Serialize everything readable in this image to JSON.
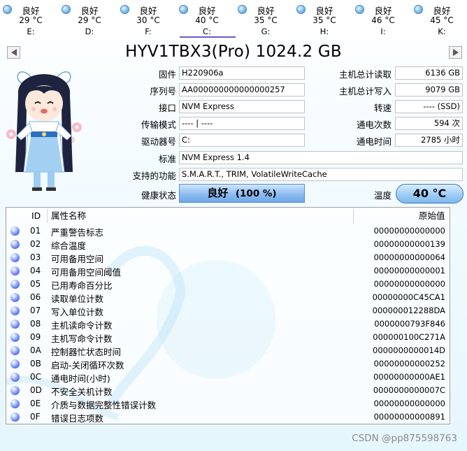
{
  "drives": [
    {
      "status": "良好",
      "temp": "29 °C",
      "letter": "E:"
    },
    {
      "status": "良好",
      "temp": "29 °C",
      "letter": "D:"
    },
    {
      "status": "良好",
      "temp": "30 °C",
      "letter": "F:"
    },
    {
      "status": "良好",
      "temp": "40 °C",
      "letter": "C:",
      "active": true
    },
    {
      "status": "良好",
      "temp": "35 °C",
      "letter": "G:"
    },
    {
      "status": "良好",
      "temp": "35 °C",
      "letter": "H:"
    },
    {
      "status": "良好",
      "temp": "46 °C",
      "letter": "I:"
    },
    {
      "status": "良好",
      "temp": "45 °C",
      "letter": "K:"
    }
  ],
  "title": "HYV1TBX3(Pro) 1024.2 GB",
  "info": {
    "firmware": {
      "label": "固件",
      "value": "H220906a"
    },
    "serial": {
      "label": "序列号",
      "value": "AA000000000000000257"
    },
    "interface": {
      "label": "接口",
      "value": "NVM Express"
    },
    "transfer": {
      "label": "传输模式",
      "value": "---- | ----"
    },
    "drive_letter": {
      "label": "驱动器号",
      "value": "C:"
    },
    "standard": {
      "label": "标准",
      "value": "NVM Express 1.4"
    },
    "features": {
      "label": "支持的功能",
      "value": "S.M.A.R.T., TRIM, VolatileWriteCache"
    },
    "host_reads": {
      "label": "主机总计读取",
      "value": "6136 GB"
    },
    "host_writes": {
      "label": "主机总计写入",
      "value": "9079 GB"
    },
    "rotation": {
      "label": "转速",
      "value": "---- (SSD)"
    },
    "power_count": {
      "label": "通电次数",
      "value": "594 次"
    },
    "power_hours": {
      "label": "通电时间",
      "value": "2785 小时"
    }
  },
  "health": {
    "label": "健康状态",
    "status": "良好",
    "percent": "(100 %)"
  },
  "temperature": {
    "label": "温度",
    "value": "40 °C"
  },
  "table": {
    "headers": {
      "id": "ID",
      "name": "属性名称",
      "raw": "原始值"
    },
    "rows": [
      {
        "id": "01",
        "name": "严重警告标志",
        "raw": "00000000000000"
      },
      {
        "id": "02",
        "name": "综合温度",
        "raw": "00000000000139"
      },
      {
        "id": "03",
        "name": "可用备用空间",
        "raw": "00000000000064"
      },
      {
        "id": "04",
        "name": "可用备用空间阈值",
        "raw": "00000000000001"
      },
      {
        "id": "05",
        "name": "已用寿命百分比",
        "raw": "00000000000000"
      },
      {
        "id": "06",
        "name": "读取单位计数",
        "raw": "00000000C45CA1"
      },
      {
        "id": "07",
        "name": "写入单位计数",
        "raw": "000000012288DA"
      },
      {
        "id": "08",
        "name": "主机读命令计数",
        "raw": "0000000793F846"
      },
      {
        "id": "09",
        "name": "主机写命令计数",
        "raw": "000000100C271A"
      },
      {
        "id": "0A",
        "name": "控制器忙状态时间",
        "raw": "0000000000014D"
      },
      {
        "id": "0B",
        "name": "启动-关闭循环次数",
        "raw": "00000000000252"
      },
      {
        "id": "0C",
        "name": "通电时间(小时)",
        "raw": "00000000000AE1"
      },
      {
        "id": "0D",
        "name": "不安全关机计数",
        "raw": "0000000000007C"
      },
      {
        "id": "0E",
        "name": "介质与数据完整性错误计数",
        "raw": "00000000000000"
      },
      {
        "id": "0F",
        "name": "错误日志项数",
        "raw": "00000000000891"
      }
    ]
  },
  "watermark": "CSDN @pp875598763",
  "colors": {
    "accent": "#6a5acd",
    "health_fill": "#8cbcf1",
    "temp_fill": "#9fcdf6"
  }
}
